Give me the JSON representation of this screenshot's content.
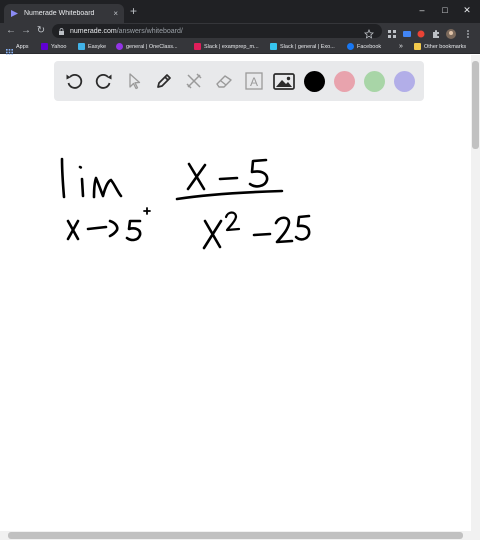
{
  "browser": {
    "tab_title": "Numerade Whiteboard",
    "tab_close": "×",
    "new_tab": "+",
    "url_host": "numerade.com",
    "url_path": "/answers/whiteboard/",
    "window_controls": {
      "minimize": "–",
      "maximize": "□",
      "close": "✕"
    },
    "nav": {
      "back": "←",
      "forward": "→",
      "reload": "↻"
    }
  },
  "bookmarks": {
    "items": [
      {
        "label": "Apps",
        "color": "#8ab4f8"
      },
      {
        "label": "Yahoo",
        "color": "#6001d2"
      },
      {
        "label": "Easyke",
        "color": "#41b3e8"
      },
      {
        "label": "general | OneClass...",
        "color": "#9334e6"
      },
      {
        "label": "Slack | examprep_m...",
        "color": "#e01e5a"
      },
      {
        "label": "Slack | general | Exo...",
        "color": "#36c5f0"
      },
      {
        "label": "Facebook",
        "color": "#1877f2"
      }
    ],
    "more": "»",
    "other": "Other bookmarks"
  },
  "whiteboard": {
    "tools": [
      {
        "name": "undo-icon"
      },
      {
        "name": "redo-icon"
      },
      {
        "name": "select-pointer-icon"
      },
      {
        "name": "pen-icon"
      },
      {
        "name": "tools-icon"
      },
      {
        "name": "eraser-icon"
      },
      {
        "name": "text-icon",
        "glyph": "A"
      },
      {
        "name": "image-icon"
      }
    ],
    "colors": [
      "#000000",
      "#e8a3ad",
      "#a8d5a7",
      "#b2aee8"
    ],
    "ink_color": "#000000"
  }
}
